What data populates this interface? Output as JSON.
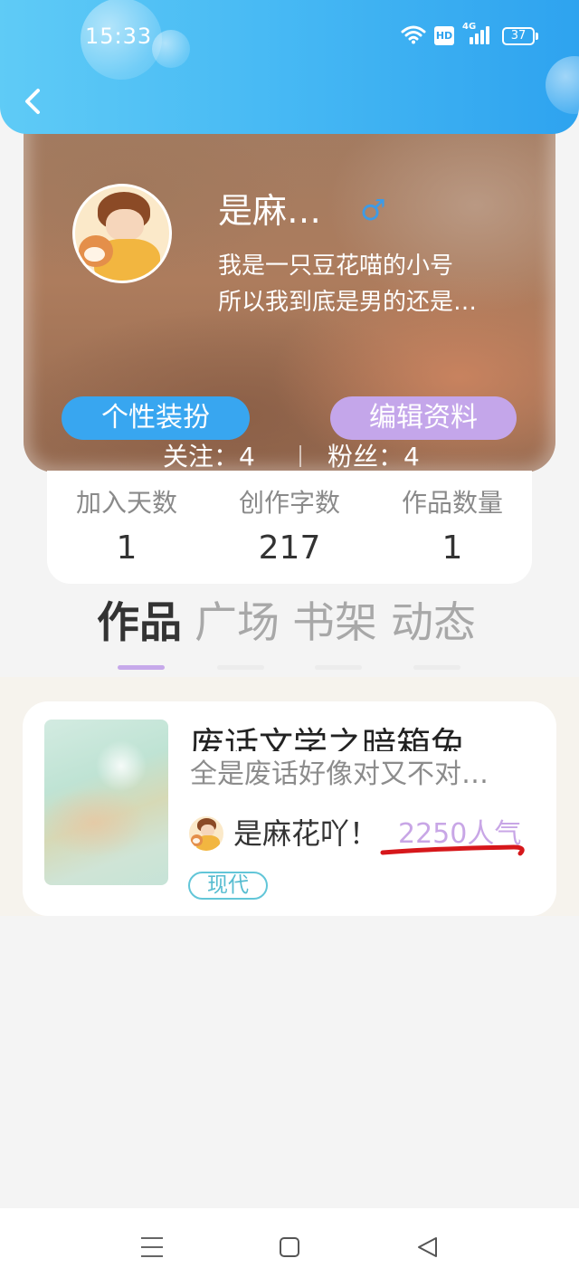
{
  "status_bar": {
    "time": "15:33",
    "hd_badge": "HD",
    "network_type": "4G",
    "battery_level": "37",
    "wifi_icon": "wifi-icon",
    "signal_icon": "signal-bars-icon",
    "battery_icon": "battery-icon"
  },
  "header": {
    "back_icon": "chevron-left-icon"
  },
  "profile": {
    "name": "是麻…",
    "gender_symbol": "♂",
    "bio_lines": [
      "我是一只豆花喵的小号",
      "所以我到底是男的还是…"
    ],
    "dress_up_button": "个性装扮",
    "edit_profile_button": "编辑资料",
    "following_label": "关注：",
    "following_count": "4",
    "followers_label": "粉丝：",
    "followers_count": "4"
  },
  "stats": [
    {
      "label": "加入天数",
      "value": "1"
    },
    {
      "label": "创作字数",
      "value": "217"
    },
    {
      "label": "作品数量",
      "value": "1"
    }
  ],
  "tabs": [
    {
      "label": "作品",
      "active": true
    },
    {
      "label": "广场",
      "active": false
    },
    {
      "label": "书架",
      "active": false
    },
    {
      "label": "动态",
      "active": false
    }
  ],
  "works": [
    {
      "title": "废话文学之暗箱兔",
      "description": "全是废话好像对又不对…",
      "author": "是麻花吖！",
      "popularity": "2250人气",
      "tag": "现代"
    }
  ],
  "bottom_nav": {
    "menu_icon": "menu-icon",
    "home_icon": "square-home-icon",
    "back_icon": "triangle-back-icon"
  },
  "colors": {
    "header_gradient_start": "#5fcbf6",
    "header_gradient_end": "#2ea3ef",
    "dress_up_button": "#38a6f0",
    "edit_button": "#c4a6ea",
    "gender_male": "#3d9be6",
    "popularity_text": "#c8a6e6",
    "tag_teal": "#5ec4d6",
    "annotation_red": "#d6171b",
    "active_tab_indicator": "#c6a9ea"
  }
}
